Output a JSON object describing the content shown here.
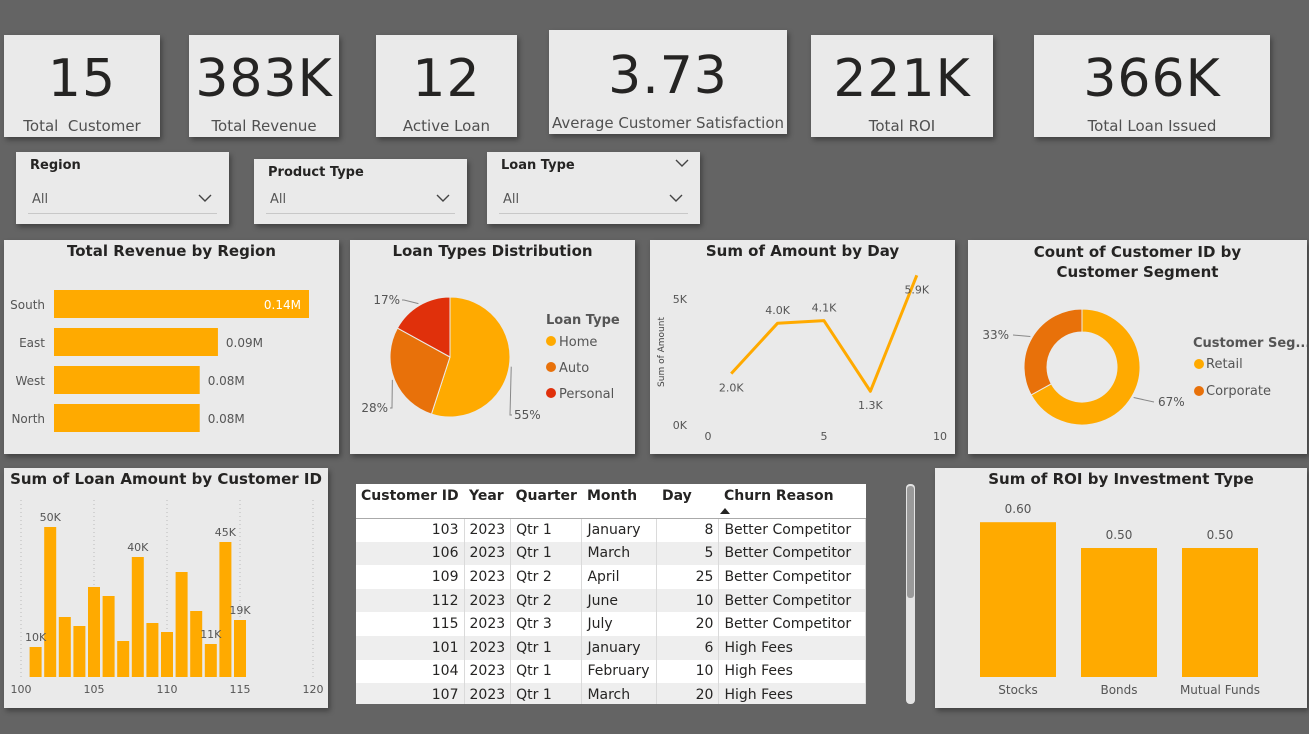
{
  "kpis": [
    {
      "value": "15",
      "label": "Total  Customer"
    },
    {
      "value": "383K",
      "label": "Total Revenue"
    },
    {
      "value": "12",
      "label": "Active Loan"
    },
    {
      "value": "3.73",
      "label": "Average Customer Satisfaction"
    },
    {
      "value": "221K",
      "label": "Total ROI"
    },
    {
      "value": "366K",
      "label": "Total Loan Issued"
    }
  ],
  "slicers": [
    {
      "title": "Region",
      "value": "All"
    },
    {
      "title": "Product Type",
      "value": "All"
    },
    {
      "title": "Loan Type",
      "value": "All"
    }
  ],
  "colors": {
    "gold": "#FFAA00",
    "orange": "#E8710A",
    "red": "#E0300B",
    "background": "#646464",
    "card": "#EAEAEA"
  },
  "charts": {
    "revenue_by_region": {
      "title": "Total Revenue by Region",
      "type": "bar",
      "categories": [
        "South",
        "East",
        "West",
        "North"
      ],
      "values": [
        0.14,
        0.09,
        0.08,
        0.08
      ],
      "labels": [
        "0.14M",
        "0.09M",
        "0.08M",
        "0.08M"
      ]
    },
    "loan_types": {
      "title": "Loan Types Distribution",
      "type": "pie",
      "legend_title": "Loan Type",
      "slices": [
        {
          "name": "Home",
          "value": 55,
          "label": "55%"
        },
        {
          "name": "Auto",
          "value": 28,
          "label": "28%"
        },
        {
          "name": "Personal",
          "value": 17,
          "label": "17%"
        }
      ]
    },
    "amount_by_day": {
      "title": "Sum of Amount by Day",
      "type": "line",
      "ylabel": "Sum of Amount",
      "x": [
        1,
        3,
        5,
        7,
        9
      ],
      "y": [
        2.0,
        4.0,
        4.1,
        1.3,
        5.9
      ],
      "labels": [
        "2.0K",
        "4.0K",
        "4.1K",
        "1.3K",
        "5.9K"
      ],
      "xticks": [
        "0",
        "5",
        "10"
      ],
      "yticks": [
        "0K",
        "5K"
      ]
    },
    "customer_segment": {
      "title": "Count of Customer ID by Customer Segment",
      "type": "donut",
      "legend_title": "Customer Seg...",
      "slices": [
        {
          "name": "Retail",
          "value": 67,
          "label": "67%"
        },
        {
          "name": "Corporate",
          "value": 33,
          "label": "33%"
        }
      ]
    },
    "loan_by_customer": {
      "title": "Sum of Loan Amount by Customer ID",
      "type": "bar",
      "x": [
        101,
        102,
        103,
        104,
        105,
        106,
        107,
        108,
        109,
        110,
        111,
        112,
        113,
        114,
        115
      ],
      "values": [
        10,
        50,
        20,
        17,
        30,
        27,
        12,
        40,
        18,
        15,
        35,
        22,
        11,
        45,
        19
      ],
      "data_labels": [
        {
          "x": 101,
          "text": "10K"
        },
        {
          "x": 102,
          "text": "50K"
        },
        {
          "x": 108,
          "text": "40K"
        },
        {
          "x": 113,
          "text": "11K"
        },
        {
          "x": 114,
          "text": "45K"
        },
        {
          "x": 115,
          "text": "19K"
        }
      ],
      "xticks": [
        "100",
        "105",
        "110",
        "115",
        "120"
      ]
    },
    "roi_by_investment": {
      "title": "Sum of ROI by Investment Type",
      "type": "bar",
      "categories": [
        "Stocks",
        "Bonds",
        "Mutual Funds"
      ],
      "values": [
        0.6,
        0.5,
        0.5
      ],
      "labels": [
        "0.60",
        "0.50",
        "0.50"
      ]
    }
  },
  "table": {
    "columns": [
      "Customer ID",
      "Year",
      "Quarter",
      "Month",
      "Day",
      "Churn Reason"
    ],
    "rows": [
      [
        "103",
        "2023",
        "Qtr 1",
        "January",
        "8",
        "Better Competitor"
      ],
      [
        "106",
        "2023",
        "Qtr 1",
        "March",
        "5",
        "Better Competitor"
      ],
      [
        "109",
        "2023",
        "Qtr 2",
        "April",
        "25",
        "Better Competitor"
      ],
      [
        "112",
        "2023",
        "Qtr 2",
        "June",
        "10",
        "Better Competitor"
      ],
      [
        "115",
        "2023",
        "Qtr 3",
        "July",
        "20",
        "Better Competitor"
      ],
      [
        "101",
        "2023",
        "Qtr 1",
        "January",
        "6",
        "High Fees"
      ],
      [
        "104",
        "2023",
        "Qtr 1",
        "February",
        "10",
        "High Fees"
      ],
      [
        "107",
        "2023",
        "Qtr 1",
        "March",
        "20",
        "High Fees"
      ]
    ]
  }
}
